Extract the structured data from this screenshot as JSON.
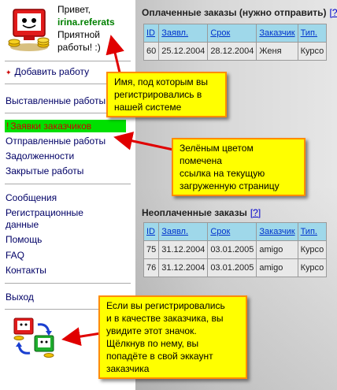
{
  "user": {
    "greeting": "Привет,",
    "username": "irina.referats",
    "wish_line1": "Приятной",
    "wish_line2": "работы! :)"
  },
  "sidebar": {
    "add_job": "Добавить работу",
    "posted": "Выставленные работы",
    "requests": "Заявки заказчиков",
    "sent": "Отправленные работы",
    "debts": "Задолженности",
    "closed": "Закрытые работы",
    "messages": "Сообщения",
    "reg_line1": "Регистрационные",
    "reg_line2": "данные",
    "help": "Помощь",
    "faq": "FAQ",
    "contacts": "Контакты",
    "logout": "Выход",
    "current_marker": "!"
  },
  "paid_orders": {
    "title": "Оплаченные заказы (нужно отправить)",
    "help": "[?]",
    "columns": [
      "ID",
      "Заявл.",
      "Срок",
      "Заказчик",
      "Тип."
    ],
    "rows": [
      [
        "60",
        "25.12.2004",
        "28.12.2004",
        "Женя",
        "Курсо"
      ]
    ]
  },
  "unpaid_orders": {
    "title": "Неоплаченные заказы",
    "help": "[?]",
    "columns": [
      "ID",
      "Заявл.",
      "Срок",
      "Заказчик",
      "Тип."
    ],
    "rows": [
      [
        "75",
        "31.12.2004",
        "03.01.2005",
        "amigo",
        "Курсо"
      ],
      [
        "76",
        "31.12.2004",
        "03.01.2005",
        "amigo",
        "Курсо"
      ]
    ]
  },
  "callouts": {
    "name": [
      "Имя, под которым вы",
      "регистрировались в",
      "нашей системе"
    ],
    "green": [
      "Зелёным цветом помечена",
      "ссылка на текущую",
      "загруженную страницу"
    ],
    "customer": [
      "Если вы регистрировались",
      "и в качестве заказчика, вы",
      "увидите этот значок.",
      "Щёлкнув по нему, вы",
      "попадёте в свой эккаунт",
      "заказчика"
    ]
  },
  "colors": {
    "current_link_bg": "#00e000",
    "callout_bg": "#ffff00",
    "table_header_bg": "#9fd8ea",
    "arrow": "#e00000"
  }
}
